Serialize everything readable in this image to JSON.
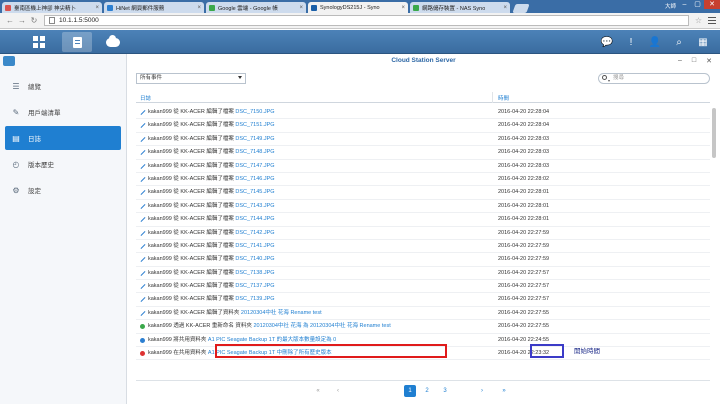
{
  "browser": {
    "tabs": [
      {
        "label": "臺南區機上神卻 神尖精卜",
        "color": "#d9534f",
        "active": false
      },
      {
        "label": "HiNet 網頁郵件服務",
        "color": "#2c7fd1",
        "active": false
      },
      {
        "label": "Google 雲端 - Google 帳",
        "color": "#3aa84a",
        "active": false
      },
      {
        "label": "SynologyDS215J - Syno",
        "color": "#1a5fa8",
        "active": true
      },
      {
        "label": "網路儲存裝置 - NAS Syno",
        "color": "#3aa84a",
        "active": false
      }
    ],
    "user": "大師",
    "url": "10.1.1.5:5000"
  },
  "sidebar": {
    "items": [
      {
        "label": "總覽",
        "icon": "list-icon",
        "glyph": "☰",
        "active": false
      },
      {
        "label": "用戶端清單",
        "icon": "wrench-icon",
        "glyph": "✎",
        "active": false
      },
      {
        "label": "日誌",
        "icon": "document-icon",
        "glyph": "▤",
        "active": true
      },
      {
        "label": "版本歷史",
        "icon": "history-icon",
        "glyph": "◴",
        "active": false
      },
      {
        "label": "設定",
        "icon": "gear-icon",
        "glyph": "⚙",
        "active": false
      }
    ]
  },
  "window": {
    "title": "Cloud Station Server"
  },
  "filter": {
    "value": "所有事件"
  },
  "search": {
    "placeholder": "搜尋"
  },
  "table": {
    "headers": [
      "日誌",
      "時間"
    ],
    "rows": [
      {
        "icon": "edit",
        "prefix": "kakan999 從 KK-ACER 編輯了檔案 ",
        "link": "DSC_7150.JPG",
        "time": "2016-04-20 22:28:04"
      },
      {
        "icon": "edit",
        "prefix": "kakan999 從 KK-ACER 編輯了檔案 ",
        "link": "DSC_7151.JPG",
        "time": "2016-04-20 22:28:04"
      },
      {
        "icon": "edit",
        "prefix": "kakan999 從 KK-ACER 編輯了檔案 ",
        "link": "DSC_7149.JPG",
        "time": "2016-04-20 22:28:03"
      },
      {
        "icon": "edit",
        "prefix": "kakan999 從 KK-ACER 編輯了檔案 ",
        "link": "DSC_7148.JPG",
        "time": "2016-04-20 22:28:03"
      },
      {
        "icon": "edit",
        "prefix": "kakan999 從 KK-ACER 編輯了檔案 ",
        "link": "DSC_7147.JPG",
        "time": "2016-04-20 22:28:03"
      },
      {
        "icon": "edit",
        "prefix": "kakan999 從 KK-ACER 編輯了檔案 ",
        "link": "DSC_7146.JPG",
        "time": "2016-04-20 22:28:02"
      },
      {
        "icon": "edit",
        "prefix": "kakan999 從 KK-ACER 編輯了檔案 ",
        "link": "DSC_7145.JPG",
        "time": "2016-04-20 22:28:01"
      },
      {
        "icon": "edit",
        "prefix": "kakan999 從 KK-ACER 編輯了檔案 ",
        "link": "DSC_7143.JPG",
        "time": "2016-04-20 22:28:01"
      },
      {
        "icon": "edit",
        "prefix": "kakan999 從 KK-ACER 編輯了檔案 ",
        "link": "DSC_7144.JPG",
        "time": "2016-04-20 22:28:01"
      },
      {
        "icon": "edit",
        "prefix": "kakan999 從 KK-ACER 編輯了檔案 ",
        "link": "DSC_7142.JPG",
        "time": "2016-04-20 22:27:59"
      },
      {
        "icon": "edit",
        "prefix": "kakan999 從 KK-ACER 編輯了檔案 ",
        "link": "DSC_7141.JPG",
        "time": "2016-04-20 22:27:59"
      },
      {
        "icon": "edit",
        "prefix": "kakan999 從 KK-ACER 編輯了檔案 ",
        "link": "DSC_7140.JPG",
        "time": "2016-04-20 22:27:59"
      },
      {
        "icon": "edit",
        "prefix": "kakan999 從 KK-ACER 編輯了檔案 ",
        "link": "DSC_7138.JPG",
        "time": "2016-04-20 22:27:57"
      },
      {
        "icon": "edit",
        "prefix": "kakan999 從 KK-ACER 編輯了檔案 ",
        "link": "DSC_7137.JPG",
        "time": "2016-04-20 22:27:57"
      },
      {
        "icon": "edit",
        "prefix": "kakan999 從 KK-ACER 編輯了檔案 ",
        "link": "DSC_7139.JPG",
        "time": "2016-04-20 22:27:57"
      },
      {
        "icon": "edit",
        "prefix": "kakan999 從 KK-ACER 編輯了資料夾 ",
        "link": "20120304中社 花海 Rename test",
        "time": "2016-04-20 22:27:55"
      },
      {
        "icon": "add",
        "prefix": "kakan999 透過 KK-ACER 重新命名 資料夾 ",
        "link": "20120304中社 花海 為 20120304中社 花海 Rename test",
        "time": "2016-04-20 22:27:55"
      },
      {
        "icon": "move",
        "prefix": "kakan999 將共用資料夾 ",
        "link": "A1 PIC Seagate Backup 1T 的最大版本數量設定為 0",
        "time": "2016-04-20 22:24:55"
      },
      {
        "icon": "del",
        "prefix": "kakan999 在共用資料夾 ",
        "link": "A1 PIC Seagate Backup 1T 中刪除了所有歷史版本",
        "time": "2016-04-20 22:23:32"
      }
    ]
  },
  "annotation": {
    "label": "開始時間"
  },
  "pager": {
    "first": "«",
    "prev": "‹",
    "pages": [
      "1",
      "2",
      "3"
    ],
    "next": "›",
    "last": "»"
  }
}
